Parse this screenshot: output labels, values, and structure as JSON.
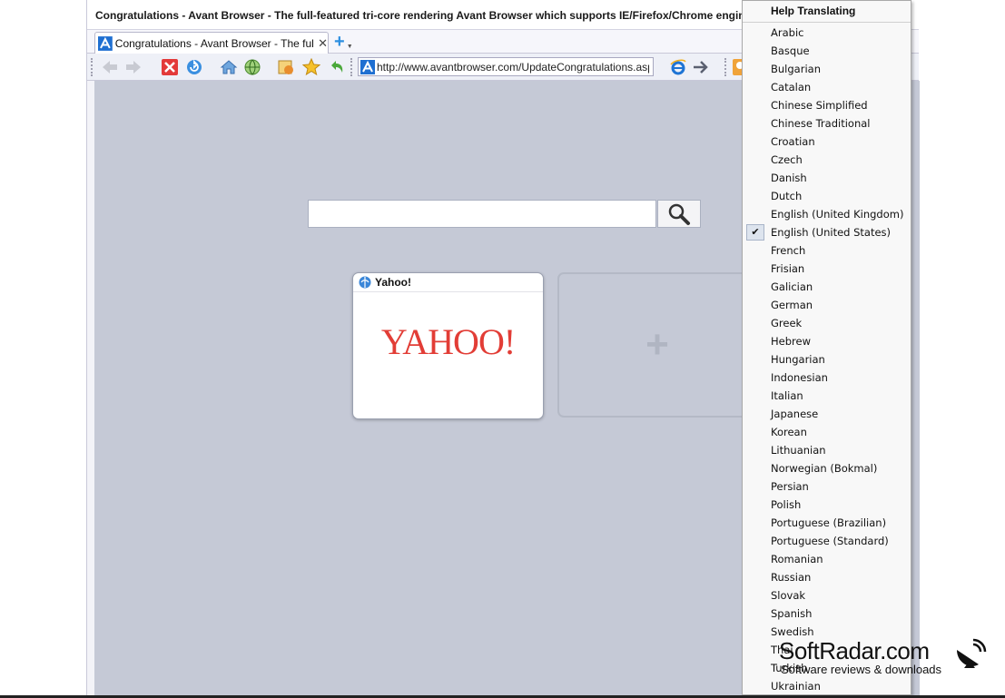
{
  "window": {
    "title": "Congratulations - Avant Browser - The full-featured tri-core rendering Avant Browser which supports IE/Firefox/Chrome engine"
  },
  "tabs": [
    {
      "label": "Congratulations - Avant Browser - The full-featured tri-core rendering Avant Browser",
      "active": true
    }
  ],
  "toolbar": {
    "address": "http://www.avantbrowser.com/UpdateCongratulations.aspx"
  },
  "content": {
    "search_value": "",
    "tiles": [
      {
        "title": "Yahoo!",
        "logo_text": "YAHOO!"
      }
    ],
    "add_tile_symbol": "+"
  },
  "language_menu": {
    "header": "Help Translating",
    "items": [
      "Arabic",
      "Basque",
      "Bulgarian",
      "Catalan",
      "Chinese Simplified",
      "Chinese Traditional",
      "Croatian",
      "Czech",
      "Danish",
      "Dutch",
      "English (United Kingdom)",
      "English (United States)",
      "French",
      "Frisian",
      "Galician",
      "German",
      "Greek",
      "Hebrew",
      "Hungarian",
      "Indonesian",
      "Italian",
      "Japanese",
      "Korean",
      "Lithuanian",
      "Norwegian (Bokmal)",
      "Persian",
      "Polish",
      "Portuguese (Brazilian)",
      "Portuguese (Standard)",
      "Romanian",
      "Russian",
      "Slovak",
      "Spanish",
      "Swedish",
      "Thai",
      "Turkish",
      "Ukrainian"
    ],
    "checked": "English (United States)"
  },
  "watermark": {
    "name": "SoftRadar.com",
    "tagline": "Software reviews & downloads"
  },
  "colors": {
    "accent": "#2d8fe0",
    "content_bg": "#c5c9d6",
    "yahoo_red": "#e23d36"
  }
}
